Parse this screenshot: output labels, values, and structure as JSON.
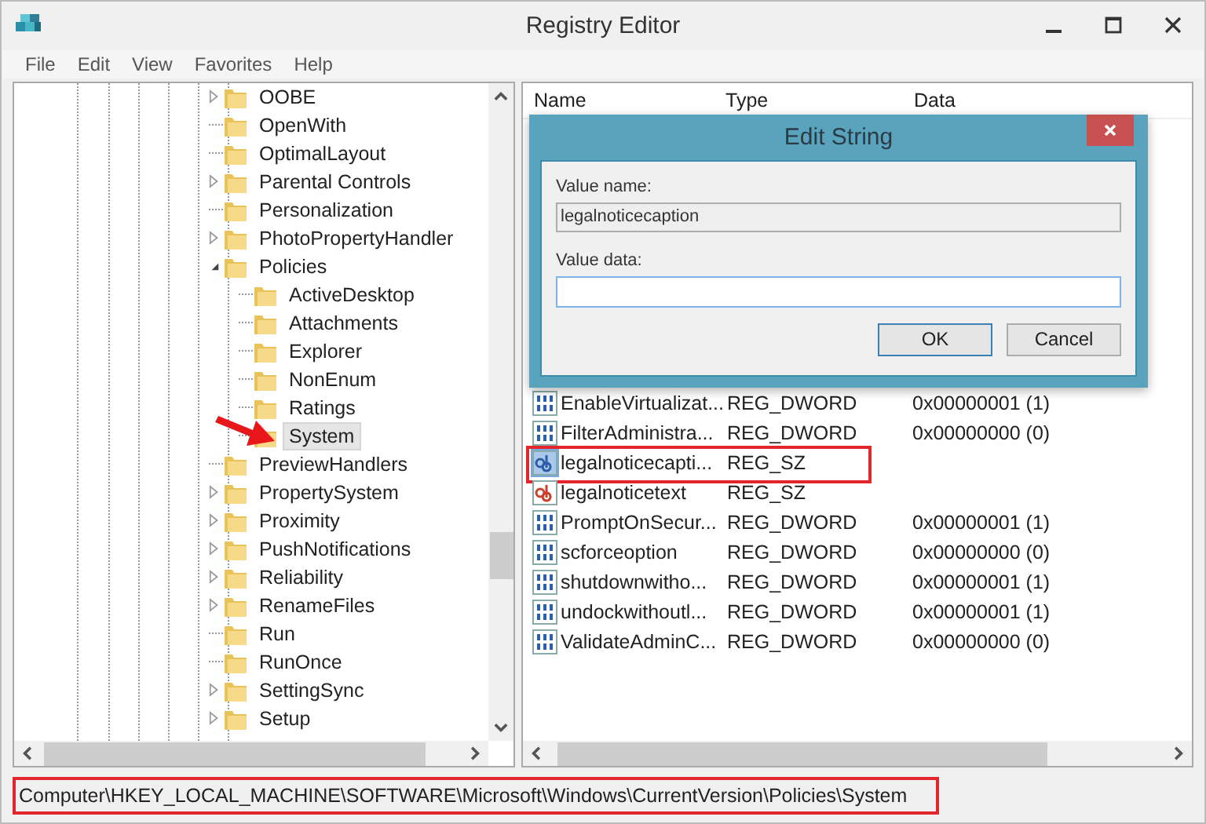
{
  "window": {
    "title": "Registry Editor"
  },
  "menu": [
    "File",
    "Edit",
    "View",
    "Favorites",
    "Help"
  ],
  "tree": {
    "items": [
      {
        "label": "OOBE",
        "kind": "branch",
        "expanded": false,
        "selected": false,
        "annotated": false
      },
      {
        "label": "OpenWith",
        "kind": "leaf",
        "selected": false,
        "annotated": false
      },
      {
        "label": "OptimalLayout",
        "kind": "leaf",
        "selected": false,
        "annotated": false
      },
      {
        "label": "Parental Controls",
        "kind": "branch",
        "expanded": false,
        "selected": false,
        "annotated": false
      },
      {
        "label": "Personalization",
        "kind": "leaf",
        "selected": false,
        "annotated": false
      },
      {
        "label": "PhotoPropertyHandler",
        "kind": "branch",
        "expanded": false,
        "selected": false,
        "annotated": false
      },
      {
        "label": "Policies",
        "kind": "branch",
        "expanded": true,
        "selected": false,
        "annotated": false,
        "children": [
          {
            "label": "ActiveDesktop",
            "kind": "leaf",
            "selected": false,
            "annotated": false
          },
          {
            "label": "Attachments",
            "kind": "leaf",
            "selected": false,
            "annotated": false
          },
          {
            "label": "Explorer",
            "kind": "leaf",
            "selected": false,
            "annotated": false
          },
          {
            "label": "NonEnum",
            "kind": "leaf",
            "selected": false,
            "annotated": false
          },
          {
            "label": "Ratings",
            "kind": "leaf",
            "selected": false,
            "annotated": false
          },
          {
            "label": "System",
            "kind": "leaf",
            "selected": true,
            "annotated": true
          }
        ]
      },
      {
        "label": "PreviewHandlers",
        "kind": "leaf",
        "selected": false,
        "annotated": false
      },
      {
        "label": "PropertySystem",
        "kind": "branch",
        "expanded": false,
        "selected": false,
        "annotated": false
      },
      {
        "label": "Proximity",
        "kind": "branch",
        "expanded": false,
        "selected": false,
        "annotated": false
      },
      {
        "label": "PushNotifications",
        "kind": "branch",
        "expanded": false,
        "selected": false,
        "annotated": false
      },
      {
        "label": "Reliability",
        "kind": "branch",
        "expanded": false,
        "selected": false,
        "annotated": false
      },
      {
        "label": "RenameFiles",
        "kind": "branch",
        "expanded": false,
        "selected": false,
        "annotated": false
      },
      {
        "label": "Run",
        "kind": "leaf",
        "selected": false,
        "annotated": false
      },
      {
        "label": "RunOnce",
        "kind": "leaf",
        "selected": false,
        "annotated": false
      },
      {
        "label": "SettingSync",
        "kind": "branch",
        "expanded": false,
        "selected": false,
        "annotated": false
      },
      {
        "label": "Setup",
        "kind": "branch",
        "expanded": false,
        "selected": false,
        "annotated": false
      }
    ]
  },
  "values": {
    "columns": [
      "Name",
      "Type",
      "Data"
    ],
    "rows": [
      {
        "kind": "dword",
        "name": "EnableVirtualizat...",
        "type": "REG_DWORD",
        "data": "0x00000001 (1)",
        "selected": false,
        "annotated": false
      },
      {
        "kind": "dword",
        "name": "FilterAdministra...",
        "type": "REG_DWORD",
        "data": "0x00000000 (0)",
        "selected": false,
        "annotated": false
      },
      {
        "kind": "string",
        "name": "legalnoticecapti...",
        "type": "REG_SZ",
        "selected": true,
        "annotated": true
      },
      {
        "kind": "string",
        "name": "legalnoticetext",
        "type": "REG_SZ",
        "selected": false,
        "annotated": false
      },
      {
        "kind": "dword",
        "name": "PromptOnSecur...",
        "type": "REG_DWORD",
        "data": "0x00000001 (1)",
        "selected": false,
        "annotated": false
      },
      {
        "kind": "dword",
        "name": "scforceoption",
        "type": "REG_DWORD",
        "data": "0x00000000 (0)",
        "selected": false,
        "annotated": false
      },
      {
        "kind": "dword",
        "name": "shutdownwitho...",
        "type": "REG_DWORD",
        "data": "0x00000001 (1)",
        "selected": false,
        "annotated": false
      },
      {
        "kind": "dword",
        "name": "undockwithoutl...",
        "type": "REG_DWORD",
        "data": "0x00000001 (1)",
        "selected": false,
        "annotated": false
      },
      {
        "kind": "dword",
        "name": "ValidateAdminC...",
        "type": "REG_DWORD",
        "data": "0x00000000 (0)",
        "selected": false,
        "annotated": false
      }
    ]
  },
  "dialog": {
    "title": "Edit String",
    "value_name_label": "Value name:",
    "value_name": "legalnoticecaption",
    "value_data_label": "Value data:",
    "buttons": [
      {
        "label": "OK",
        "default": true
      },
      {
        "label": "Cancel",
        "default": false
      }
    ]
  },
  "status_bar": {
    "path": "Computer\\HKEY_LOCAL_MACHINE\\SOFTWARE\\Microsoft\\Windows\\CurrentVersion\\Policies\\System",
    "annotated": true
  }
}
